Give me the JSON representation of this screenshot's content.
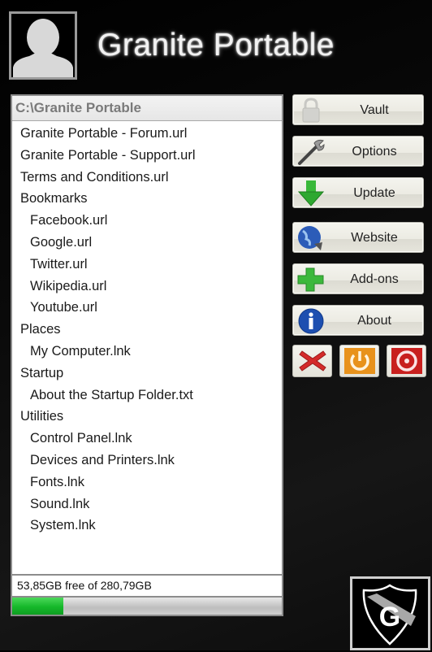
{
  "header": {
    "title": "Granite Portable",
    "avatar_icon": "user-silhouette-icon"
  },
  "file_panel": {
    "path": "C:\\Granite Portable",
    "items": [
      {
        "label": "Granite Portable - Forum.url",
        "level": 0
      },
      {
        "label": "Granite Portable - Support.url",
        "level": 0
      },
      {
        "label": "Terms and Conditions.url",
        "level": 0
      },
      {
        "label": "Bookmarks",
        "level": 0
      },
      {
        "label": "Facebook.url",
        "level": 1
      },
      {
        "label": "Google.url",
        "level": 1
      },
      {
        "label": "Twitter.url",
        "level": 1
      },
      {
        "label": "Wikipedia.url",
        "level": 1
      },
      {
        "label": "Youtube.url",
        "level": 1
      },
      {
        "label": "Places",
        "level": 0
      },
      {
        "label": "My Computer.lnk",
        "level": 1
      },
      {
        "label": "Startup",
        "level": 0
      },
      {
        "label": "About the Startup Folder.txt",
        "level": 1
      },
      {
        "label": "Utilities",
        "level": 0
      },
      {
        "label": "Control Panel.lnk",
        "level": 1
      },
      {
        "label": "Devices and Printers.lnk",
        "level": 1
      },
      {
        "label": "Fonts.lnk",
        "level": 1
      },
      {
        "label": "Sound.lnk",
        "level": 1
      },
      {
        "label": "System.lnk",
        "level": 1
      }
    ]
  },
  "disk": {
    "label": "53,85GB free of 280,79GB",
    "used_fraction": 0.19,
    "fill_color": "#1fbf33"
  },
  "buttons": [
    {
      "label": "Vault",
      "icon": "padlock-icon"
    },
    {
      "label": "Options",
      "icon": "wrench-icon"
    },
    {
      "label": "Update",
      "icon": "green-down-arrow-icon"
    },
    {
      "label": "Website",
      "icon": "globe-icon"
    },
    {
      "label": "Add-ons",
      "icon": "green-plus-icon"
    },
    {
      "label": "About",
      "icon": "info-icon"
    }
  ],
  "small_buttons": [
    {
      "name": "close",
      "icon": "red-x-icon",
      "color": "#d42a2a"
    },
    {
      "name": "power",
      "icon": "orange-power-icon",
      "color": "#e8921c"
    },
    {
      "name": "shutdown",
      "icon": "red-power-icon",
      "color": "#c8201e"
    }
  ],
  "logo": {
    "letter": "G",
    "icon": "shield-logo-icon"
  }
}
